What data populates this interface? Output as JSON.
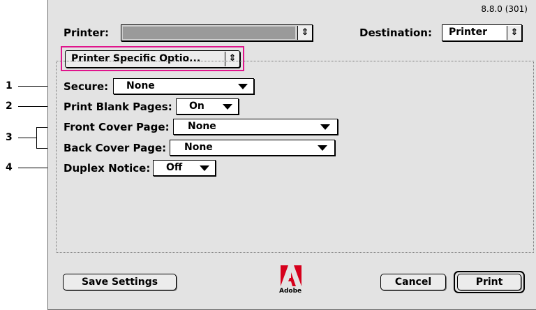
{
  "dialog": {
    "version": "8.8.0 (301)",
    "printer_label": "Printer:",
    "printer_value": "",
    "destination_label": "Destination:",
    "destination_value": "Printer",
    "panel_menu_value": "Printer Specific Optio...",
    "highlight_color": "#e0148c",
    "options": [
      {
        "label": "Secure:",
        "value": "None"
      },
      {
        "label": "Print Blank Pages:",
        "value": "On"
      },
      {
        "label": "Front Cover Page:",
        "value": "None"
      },
      {
        "label": "Back Cover Page:",
        "value": "None"
      },
      {
        "label": "Duplex Notice:",
        "value": "Off"
      }
    ],
    "buttons": {
      "save_settings": "Save Settings",
      "cancel": "Cancel",
      "print": "Print"
    },
    "logo_text": "Adobe"
  },
  "callouts": [
    "1",
    "2",
    "3",
    "4"
  ],
  "icons": {
    "stepper": "up-down-arrows",
    "popup_arrow": "triangle-down",
    "logo": "adobe-logo"
  }
}
